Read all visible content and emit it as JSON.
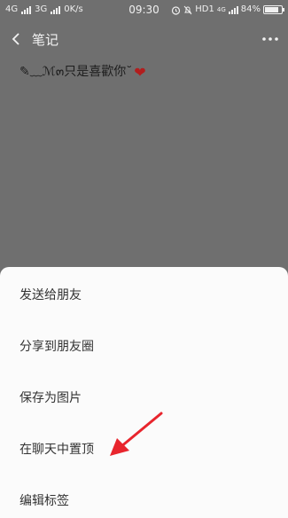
{
  "status_bar": {
    "network1": "4G",
    "network2": "3G",
    "speed": "0K/s",
    "time": "09:30",
    "hd": "HD1",
    "net_small": "4G",
    "battery_percent": "84%",
    "battery_level": 0.84
  },
  "top_bar": {
    "title": "笔记"
  },
  "note": {
    "content": "✎﹏ℳ๓只是喜歡你˘"
  },
  "menu": {
    "items": [
      {
        "label": "发送给朋友"
      },
      {
        "label": "分享到朋友圈"
      },
      {
        "label": "保存为图片"
      },
      {
        "label": "在聊天中置顶"
      },
      {
        "label": "编辑标签"
      }
    ]
  },
  "colors": {
    "overlay": "#6f6f6f",
    "sheet": "#fbfbfb",
    "arrow": "#e8252d"
  }
}
